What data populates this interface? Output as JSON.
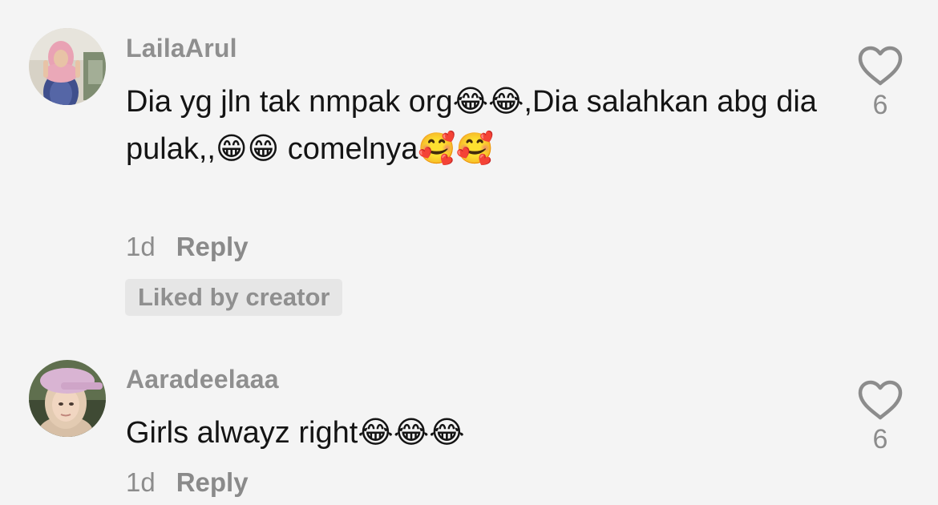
{
  "comments": [
    {
      "username": "LailaArul",
      "text": "Dia yg jln tak nmpak org😂😂,Dia salahkan abg dia pulak,,😁😁 comelnya🥰🥰",
      "time": "1d",
      "reply_label": "Reply",
      "badge": "Liked by creator",
      "likes": "6",
      "avatar_icon": "avatar-woman-pink-hijab"
    },
    {
      "username": "Aaradeelaaa",
      "text": "Girls alwayz right😂😂😂",
      "time": "1d",
      "reply_label": "Reply",
      "likes": "6",
      "avatar_icon": "avatar-woman-pink-cap"
    }
  ],
  "colors": {
    "background": "#f4f4f4",
    "username": "#8f8f8f",
    "text": "#141414",
    "meta": "#8c8c8c",
    "badge_bg": "#e6e6e6"
  }
}
